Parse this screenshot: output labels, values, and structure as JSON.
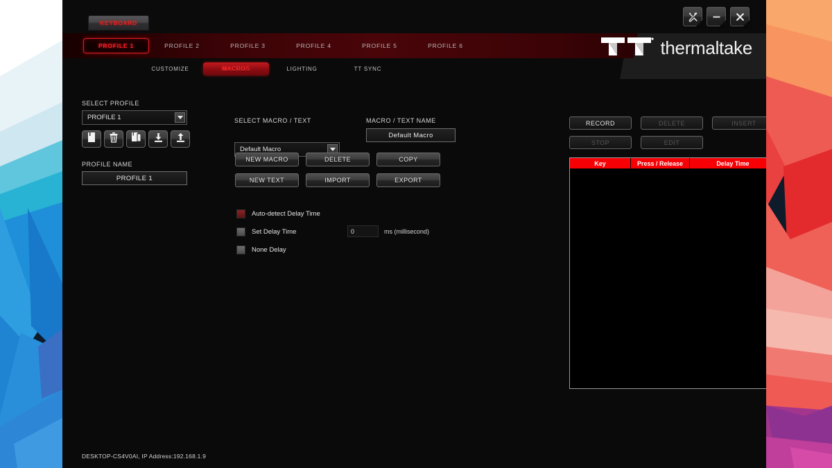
{
  "window": {
    "device_tab_label": "KEYBOARD",
    "controls": [
      {
        "name": "tools-icon",
        "label": "Tools"
      },
      {
        "name": "minimize-icon",
        "label": "Minimize"
      },
      {
        "name": "close-icon",
        "label": "Close"
      }
    ],
    "brand_text": "thermaltake"
  },
  "profile_tabs": [
    {
      "label": "PROFILE 1",
      "active": true
    },
    {
      "label": "PROFILE 2",
      "active": false
    },
    {
      "label": "PROFILE 3",
      "active": false
    },
    {
      "label": "PROFILE 4",
      "active": false
    },
    {
      "label": "PROFILE 5",
      "active": false
    },
    {
      "label": "PROFILE 6",
      "active": false
    }
  ],
  "sub_tabs": [
    {
      "label": "CUSTOMIZE",
      "active": false
    },
    {
      "label": "MACROS",
      "active": true
    },
    {
      "label": "LIGHTING",
      "active": false
    },
    {
      "label": "TT SYNC",
      "active": false
    }
  ],
  "profile_panel": {
    "select_profile_label": "SELECT PROFILE",
    "select_profile_value": "PROFILE 1",
    "icon_buttons": [
      {
        "name": "new-profile-icon",
        "title": "New"
      },
      {
        "name": "delete-profile-icon",
        "title": "Delete"
      },
      {
        "name": "copy-profile-icon",
        "title": "Copy"
      },
      {
        "name": "import-profile-icon",
        "title": "Import"
      },
      {
        "name": "export-profile-icon",
        "title": "Export"
      }
    ],
    "profile_name_label": "PROFILE NAME",
    "profile_name_value": "PROFILE 1"
  },
  "macro_panel": {
    "select_macro_label": "SELECT MACRO / TEXT",
    "select_macro_value": "Default Macro",
    "macro_name_label": "MACRO / TEXT NAME",
    "macro_name_value": "Default Macro",
    "buttons": [
      {
        "label": "NEW MACRO",
        "disabled": false
      },
      {
        "label": "DELETE",
        "disabled": false
      },
      {
        "label": "COPY",
        "disabled": false
      },
      {
        "label": "NEW TEXT",
        "disabled": false
      },
      {
        "label": "IMPORT",
        "disabled": false
      },
      {
        "label": "EXPORT",
        "disabled": false
      }
    ],
    "delay_options": [
      {
        "label": "Auto-detect Delay Time",
        "checked": true
      },
      {
        "label": "Set Delay Time",
        "checked": false
      },
      {
        "label": "None Delay",
        "checked": false
      }
    ],
    "delay_value": "0",
    "delay_unit": "ms (millisecond)"
  },
  "record_panel": {
    "buttons": [
      {
        "label": "RECORD",
        "disabled": false
      },
      {
        "label": "DELETE",
        "disabled": true
      },
      {
        "label": "INSERT",
        "disabled": true
      },
      {
        "label": "STOP",
        "disabled": true
      },
      {
        "label": "EDIT",
        "disabled": true
      }
    ],
    "table": {
      "columns": [
        "Key",
        "Press / Release",
        "Delay Time"
      ],
      "rows": []
    }
  },
  "status_bar": {
    "text": "DESKTOP-CS4V0AI, IP Address:192.168.1.9"
  },
  "colors": {
    "accent_red": "#f60006",
    "tab_red": "#ff1f26",
    "panel_bg": "#0a0a0a"
  }
}
